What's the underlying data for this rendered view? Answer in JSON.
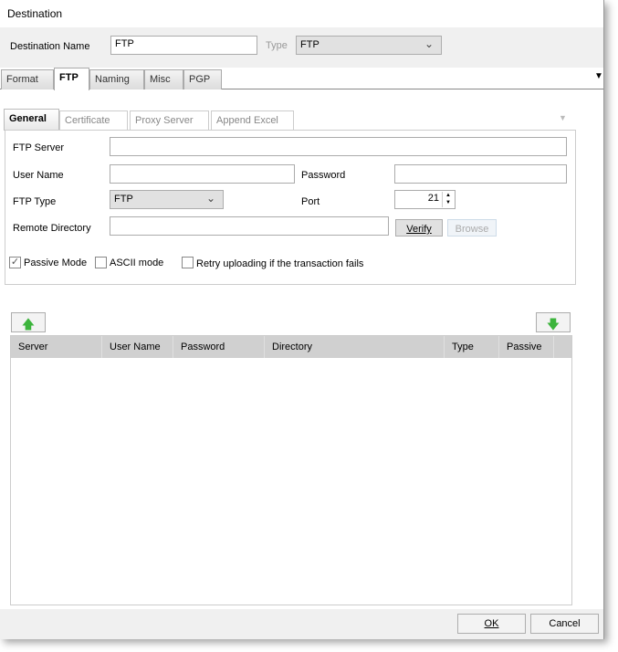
{
  "window": {
    "title": "Destination"
  },
  "header": {
    "name_label": "Destination Name",
    "name_value": "FTP",
    "type_label": "Type",
    "type_value": "FTP"
  },
  "tabs": [
    {
      "label": "Format"
    },
    {
      "label": "FTP",
      "active": true
    },
    {
      "label": "Naming"
    },
    {
      "label": "Misc"
    },
    {
      "label": "PGP"
    }
  ],
  "subtabs": [
    {
      "label": "General",
      "active": true
    },
    {
      "label": "Certificate"
    },
    {
      "label": "Proxy Server"
    },
    {
      "label": "Append Excel"
    }
  ],
  "form": {
    "ftp_server_label": "FTP Server",
    "ftp_server_value": "",
    "user_name_label": "User Name",
    "user_name_value": "",
    "password_label": "Password",
    "password_value": "",
    "ftp_type_label": "FTP Type",
    "ftp_type_value": "FTP",
    "port_label": "Port",
    "port_value": "21",
    "remote_dir_label": "Remote Directory",
    "remote_dir_value": "",
    "verify_label": "Verify",
    "browse_label": "Browse",
    "passive_label": "Passive Mode",
    "passive_checked": true,
    "ascii_label": "ASCII mode",
    "ascii_checked": false,
    "retry_label": "Retry uploading if the transaction fails",
    "retry_checked": false
  },
  "grid": {
    "columns": [
      "Server",
      "User Name",
      "Password",
      "Directory",
      "Type",
      "Passive"
    ],
    "rows": []
  },
  "footer": {
    "ok_label": "OK",
    "cancel_label": "Cancel"
  },
  "icons": {
    "up": "green-up-arrow-icon",
    "down": "green-down-arrow-icon"
  }
}
